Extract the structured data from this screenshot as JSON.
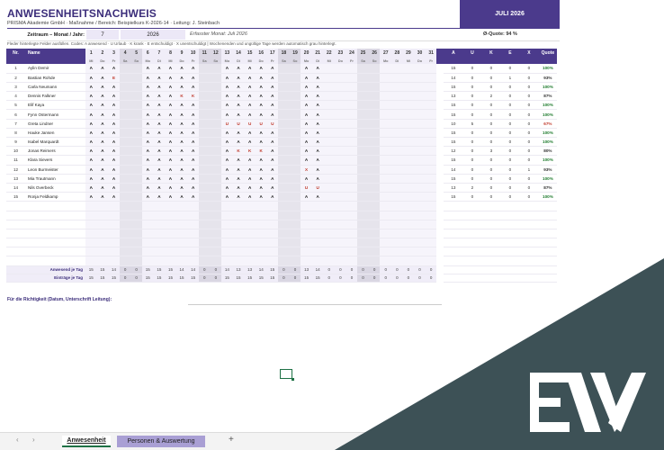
{
  "header": {
    "title": "ANWESENHEITSNACHWEIS",
    "subtitle": "PRISMA Akademie GmbH   ·   Maßnahme / Bereich: Beispielkurs K-2026-14   ·   Leitung: J. Steinbach",
    "month_badge": "JULI 2026"
  },
  "period": {
    "label": "Zeitraum – Monat / Jahr:",
    "month": "7",
    "year": "2026",
    "captured": "Erfasster Monat: Juli 2026",
    "avg_quote": "Ø-Quote: 94 %"
  },
  "hint": "Fleder hinterlegte Felder ausfüllen.   Codes:  A anwesend  ·  U Urlaub  ·  K krank  ·  E entschuldigt  ·  X unentschuldigt   |   Wochenenden und ungültige Tage werden automatisch grau hinterlegt.",
  "columns": {
    "nr": "Nr.",
    "name": "Name",
    "stats": [
      "A",
      "U",
      "K",
      "E",
      "X",
      "Quote"
    ]
  },
  "days": [
    {
      "d": "1",
      "wd": "Mi",
      "we": false
    },
    {
      "d": "2",
      "wd": "Do",
      "we": false
    },
    {
      "d": "3",
      "wd": "Fr",
      "we": false
    },
    {
      "d": "4",
      "wd": "Sa",
      "we": true
    },
    {
      "d": "5",
      "wd": "So",
      "we": true
    },
    {
      "d": "6",
      "wd": "Mo",
      "we": false
    },
    {
      "d": "7",
      "wd": "Di",
      "we": false
    },
    {
      "d": "8",
      "wd": "Mi",
      "we": false
    },
    {
      "d": "9",
      "wd": "Do",
      "we": false
    },
    {
      "d": "10",
      "wd": "Fr",
      "we": false
    },
    {
      "d": "11",
      "wd": "Sa",
      "we": true
    },
    {
      "d": "12",
      "wd": "So",
      "we": true
    },
    {
      "d": "13",
      "wd": "Mo",
      "we": false
    },
    {
      "d": "14",
      "wd": "Di",
      "we": false
    },
    {
      "d": "15",
      "wd": "Mi",
      "we": false
    },
    {
      "d": "16",
      "wd": "Do",
      "we": false
    },
    {
      "d": "17",
      "wd": "Fr",
      "we": false
    },
    {
      "d": "18",
      "wd": "Sa",
      "we": true
    },
    {
      "d": "19",
      "wd": "So",
      "we": true
    },
    {
      "d": "20",
      "wd": "Mo",
      "we": false
    },
    {
      "d": "21",
      "wd": "Di",
      "we": false
    },
    {
      "d": "22",
      "wd": "Mi",
      "we": false
    },
    {
      "d": "23",
      "wd": "Do",
      "we": false
    },
    {
      "d": "24",
      "wd": "Fr",
      "we": false
    },
    {
      "d": "25",
      "wd": "Sa",
      "we": true
    },
    {
      "d": "26",
      "wd": "So",
      "we": true
    },
    {
      "d": "27",
      "wd": "Mo",
      "we": false
    },
    {
      "d": "28",
      "wd": "Di",
      "we": false
    },
    {
      "d": "29",
      "wd": "Mi",
      "we": false
    },
    {
      "d": "30",
      "wd": "Do",
      "we": false
    },
    {
      "d": "31",
      "wd": "Fr",
      "we": false
    }
  ],
  "rows": [
    {
      "nr": "1",
      "name": "Aylin Demir",
      "marks": [
        "A",
        "A",
        "A",
        "",
        "",
        "A",
        "A",
        "A",
        "A",
        "A",
        "",
        "",
        "A",
        "A",
        "A",
        "A",
        "A",
        "",
        "",
        "A",
        "A",
        "",
        "",
        "",
        "",
        "",
        "",
        "",
        "",
        "",
        ""
      ],
      "stats": [
        "15",
        "0",
        "0",
        "0",
        "0",
        "100%"
      ]
    },
    {
      "nr": "2",
      "name": "Bastian Rohde",
      "marks": [
        "A",
        "A",
        "E",
        "",
        "",
        "A",
        "A",
        "A",
        "A",
        "A",
        "",
        "",
        "A",
        "A",
        "A",
        "A",
        "A",
        "",
        "",
        "A",
        "A",
        "",
        "",
        "",
        "",
        "",
        "",
        "",
        "",
        "",
        ""
      ],
      "stats": [
        "14",
        "0",
        "0",
        "1",
        "0",
        "93%"
      ]
    },
    {
      "nr": "3",
      "name": "Carla Neumann",
      "marks": [
        "A",
        "A",
        "A",
        "",
        "",
        "A",
        "A",
        "A",
        "A",
        "A",
        "",
        "",
        "A",
        "A",
        "A",
        "A",
        "A",
        "",
        "",
        "A",
        "A",
        "",
        "",
        "",
        "",
        "",
        "",
        "",
        "",
        "",
        ""
      ],
      "stats": [
        "15",
        "0",
        "0",
        "0",
        "0",
        "100%"
      ]
    },
    {
      "nr": "4",
      "name": "Dennis Falkner",
      "marks": [
        "A",
        "A",
        "A",
        "",
        "",
        "A",
        "A",
        "A",
        "K",
        "K",
        "",
        "",
        "A",
        "A",
        "A",
        "A",
        "A",
        "",
        "",
        "A",
        "A",
        "",
        "",
        "",
        "",
        "",
        "",
        "",
        "",
        "",
        ""
      ],
      "stats": [
        "13",
        "0",
        "2",
        "0",
        "0",
        "87%"
      ]
    },
    {
      "nr": "5",
      "name": "Elif Kaya",
      "marks": [
        "A",
        "A",
        "A",
        "",
        "",
        "A",
        "A",
        "A",
        "A",
        "A",
        "",
        "",
        "A",
        "A",
        "A",
        "A",
        "A",
        "",
        "",
        "A",
        "A",
        "",
        "",
        "",
        "",
        "",
        "",
        "",
        "",
        "",
        ""
      ],
      "stats": [
        "15",
        "0",
        "0",
        "0",
        "0",
        "100%"
      ]
    },
    {
      "nr": "6",
      "name": "Fynn Ostermann",
      "marks": [
        "A",
        "A",
        "A",
        "",
        "",
        "A",
        "A",
        "A",
        "A",
        "A",
        "",
        "",
        "A",
        "A",
        "A",
        "A",
        "A",
        "",
        "",
        "A",
        "A",
        "",
        "",
        "",
        "",
        "",
        "",
        "",
        "",
        "",
        ""
      ],
      "stats": [
        "15",
        "0",
        "0",
        "0",
        "0",
        "100%"
      ]
    },
    {
      "nr": "7",
      "name": "Greta Lindner",
      "marks": [
        "A",
        "A",
        "A",
        "",
        "",
        "A",
        "A",
        "A",
        "A",
        "A",
        "",
        "",
        "U",
        "U",
        "U",
        "U",
        "U",
        "",
        "",
        "A",
        "A",
        "",
        "",
        "",
        "",
        "",
        "",
        "",
        "",
        "",
        ""
      ],
      "stats": [
        "10",
        "5",
        "0",
        "0",
        "0",
        "67%"
      ]
    },
    {
      "nr": "8",
      "name": "Hauke Jansen",
      "marks": [
        "A",
        "A",
        "A",
        "",
        "",
        "A",
        "A",
        "A",
        "A",
        "A",
        "",
        "",
        "A",
        "A",
        "A",
        "A",
        "A",
        "",
        "",
        "A",
        "A",
        "",
        "",
        "",
        "",
        "",
        "",
        "",
        "",
        "",
        ""
      ],
      "stats": [
        "15",
        "0",
        "0",
        "0",
        "0",
        "100%"
      ]
    },
    {
      "nr": "9",
      "name": "Isabel Marquardt",
      "marks": [
        "A",
        "A",
        "A",
        "",
        "",
        "A",
        "A",
        "A",
        "A",
        "A",
        "",
        "",
        "A",
        "A",
        "A",
        "A",
        "A",
        "",
        "",
        "A",
        "A",
        "",
        "",
        "",
        "",
        "",
        "",
        "",
        "",
        "",
        ""
      ],
      "stats": [
        "15",
        "0",
        "0",
        "0",
        "0",
        "100%"
      ]
    },
    {
      "nr": "10",
      "name": "Jonas Reimers",
      "marks": [
        "A",
        "A",
        "A",
        "",
        "",
        "A",
        "A",
        "A",
        "A",
        "A",
        "",
        "",
        "A",
        "K",
        "K",
        "K",
        "A",
        "",
        "",
        "A",
        "A",
        "",
        "",
        "",
        "",
        "",
        "",
        "",
        "",
        "",
        ""
      ],
      "stats": [
        "12",
        "0",
        "3",
        "0",
        "0",
        "80%"
      ]
    },
    {
      "nr": "11",
      "name": "Klara Sievers",
      "marks": [
        "A",
        "A",
        "A",
        "",
        "",
        "A",
        "A",
        "A",
        "A",
        "A",
        "",
        "",
        "A",
        "A",
        "A",
        "A",
        "A",
        "",
        "",
        "A",
        "A",
        "",
        "",
        "",
        "",
        "",
        "",
        "",
        "",
        "",
        ""
      ],
      "stats": [
        "15",
        "0",
        "0",
        "0",
        "0",
        "100%"
      ]
    },
    {
      "nr": "12",
      "name": "Leon Burmeister",
      "marks": [
        "A",
        "A",
        "A",
        "",
        "",
        "A",
        "A",
        "A",
        "A",
        "A",
        "",
        "",
        "A",
        "A",
        "A",
        "A",
        "A",
        "",
        "",
        "X",
        "A",
        "",
        "",
        "",
        "",
        "",
        "",
        "",
        "",
        "",
        ""
      ],
      "stats": [
        "14",
        "0",
        "0",
        "0",
        "1",
        "93%"
      ]
    },
    {
      "nr": "13",
      "name": "Mia Trautmann",
      "marks": [
        "A",
        "A",
        "A",
        "",
        "",
        "A",
        "A",
        "A",
        "A",
        "A",
        "",
        "",
        "A",
        "A",
        "A",
        "A",
        "A",
        "",
        "",
        "A",
        "A",
        "",
        "",
        "",
        "",
        "",
        "",
        "",
        "",
        "",
        ""
      ],
      "stats": [
        "15",
        "0",
        "0",
        "0",
        "0",
        "100%"
      ]
    },
    {
      "nr": "14",
      "name": "Nils Overbeck",
      "marks": [
        "A",
        "A",
        "A",
        "",
        "",
        "A",
        "A",
        "A",
        "A",
        "A",
        "",
        "",
        "A",
        "A",
        "A",
        "A",
        "A",
        "",
        "",
        "U",
        "U",
        "",
        "",
        "",
        "",
        "",
        "",
        "",
        "",
        "",
        ""
      ],
      "stats": [
        "13",
        "2",
        "0",
        "0",
        "0",
        "87%"
      ]
    },
    {
      "nr": "15",
      "name": "Ronja Feldkamp",
      "marks": [
        "A",
        "A",
        "A",
        "",
        "",
        "A",
        "A",
        "A",
        "A",
        "A",
        "",
        "",
        "A",
        "A",
        "A",
        "A",
        "A",
        "",
        "",
        "A",
        "A",
        "",
        "",
        "",
        "",
        "",
        "",
        "",
        "",
        "",
        ""
      ],
      "stats": [
        "15",
        "0",
        "0",
        "0",
        "0",
        "100%"
      ]
    }
  ],
  "summary": {
    "present_label": "Anwesend je Tag",
    "present": [
      "15",
      "15",
      "14",
      "0",
      "0",
      "15",
      "15",
      "15",
      "14",
      "14",
      "0",
      "0",
      "14",
      "13",
      "13",
      "14",
      "15",
      "0",
      "0",
      "13",
      "14",
      "0",
      "0",
      "0",
      "0",
      "0",
      "0",
      "0",
      "0",
      "0",
      "0"
    ],
    "entries_label": "Einträge je Tag",
    "entries": [
      "15",
      "15",
      "15",
      "0",
      "0",
      "15",
      "15",
      "15",
      "15",
      "15",
      "0",
      "0",
      "15",
      "15",
      "15",
      "15",
      "15",
      "0",
      "0",
      "15",
      "15",
      "0",
      "0",
      "0",
      "0",
      "0",
      "0",
      "0",
      "0",
      "0",
      "0"
    ]
  },
  "signature_label": "Für die Richtigkeit (Datum, Unterschrift Leitung):",
  "tabs": {
    "active": "Anwesenheit",
    "second": "Personen & Auswertung",
    "add": "+",
    "nav_prev": "‹",
    "nav_next": "›",
    "separator": "⋮"
  },
  "colors": {
    "brand": "#4b3a8c",
    "present_good": "#1d7a2c",
    "absent_mark": "#c0392b",
    "overlay": "#3d5156"
  },
  "logo": "EW"
}
